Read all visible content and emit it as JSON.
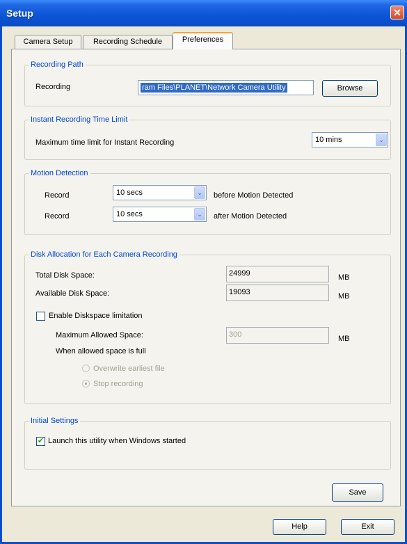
{
  "window": {
    "title": "Setup",
    "close_glyph": "✕"
  },
  "tabs": [
    {
      "label": "Camera Setup",
      "active": false
    },
    {
      "label": "Recording Schedule",
      "active": false
    },
    {
      "label": "Preferences",
      "active": true
    }
  ],
  "recording_path": {
    "legend": "Recording Path",
    "label": "Recording",
    "value": "ram Files\\PLANET\\Network Camera Utility",
    "browse_label": "Browse"
  },
  "instant_recording": {
    "legend": "Instant Recording Time Limit",
    "label": "Maximum time limit for Instant Recording",
    "value": "10 mins"
  },
  "motion_detection": {
    "legend": "Motion Detection",
    "rows": [
      {
        "label": "Record",
        "value": "10 secs",
        "suffix": "before Motion Detected"
      },
      {
        "label": "Record",
        "value": "10 secs",
        "suffix": "after Motion Detected"
      }
    ]
  },
  "disk_allocation": {
    "legend": "Disk Allocation for Each Camera Recording",
    "total_label": "Total Disk Space:",
    "total_value": "24999",
    "total_unit": "MB",
    "available_label": "Available Disk Space:",
    "available_value": "19093",
    "available_unit": "MB",
    "enable_limit_label": "Enable Diskspace limitation",
    "enable_limit_checked": false,
    "max_allowed_label": "Maximum Allowed Space:",
    "max_allowed_value": "300",
    "max_allowed_unit": "MB",
    "when_full_label": "When allowed space is full",
    "options": [
      {
        "label": "Overwrite earliest file",
        "selected": false
      },
      {
        "label": "Stop recording",
        "selected": true
      }
    ]
  },
  "initial_settings": {
    "legend": "Initial Settings",
    "launch_label": "Launch this utility when Windows started",
    "launch_checked": true,
    "check_glyph": "✔"
  },
  "buttons": {
    "save": "Save",
    "help": "Help",
    "exit": "Exit"
  },
  "icons": {
    "dropdown_arrow": "⌄"
  },
  "colors": {
    "titlebar": "#0b55d6",
    "group_legend": "#0046d5",
    "dialog_bg": "#ece9d8"
  }
}
